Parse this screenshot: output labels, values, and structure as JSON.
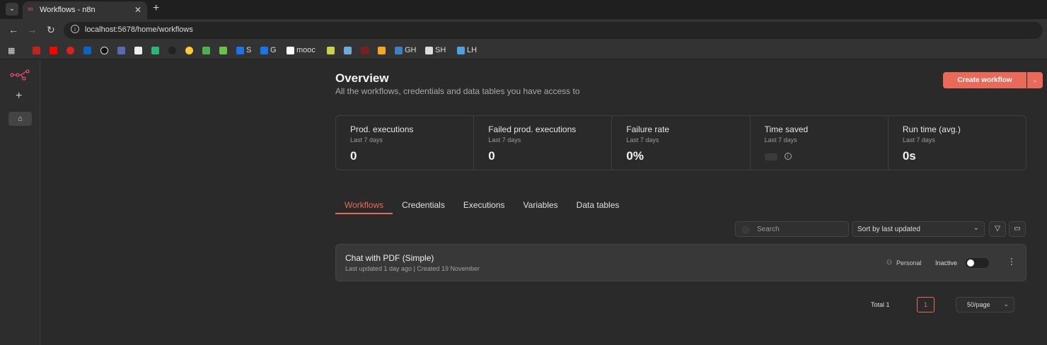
{
  "browser": {
    "tab_title": "Workflows - n8n",
    "url": "localhost:5678/home/workflows",
    "bookmarks": [
      "S",
      "G",
      "mooc",
      "GH",
      "SH",
      "LH"
    ]
  },
  "overview": {
    "title": "Overview",
    "subtitle": "All the workflows, credentials and data tables you have access to",
    "create_label": "Create workflow"
  },
  "stats": [
    {
      "label": "Prod. executions",
      "period": "Last 7 days",
      "value": "0"
    },
    {
      "label": "Failed prod. executions",
      "period": "Last 7 days",
      "value": "0"
    },
    {
      "label": "Failure rate",
      "period": "Last 7 days",
      "value": "0%"
    },
    {
      "label": "Time saved",
      "period": "Last 7 days",
      "value": ""
    },
    {
      "label": "Run time (avg.)",
      "period": "Last 7 days",
      "value": "0s"
    }
  ],
  "tabs": [
    "Workflows",
    "Credentials",
    "Executions",
    "Variables",
    "Data tables"
  ],
  "controls": {
    "search_placeholder": "Search",
    "sort_value": "Sort by last updated"
  },
  "workflows": [
    {
      "name": "Chat with PDF (Simple)",
      "updated": "Last updated 1 day ago",
      "created": "Created 19 November",
      "owner": "Personal",
      "status": "Inactive"
    }
  ],
  "pagination": {
    "total": "Total 1",
    "current_page": "1",
    "per_page": "50/page"
  },
  "colors": {
    "accent": "#ea6a59",
    "brand": "#ea4b71"
  }
}
